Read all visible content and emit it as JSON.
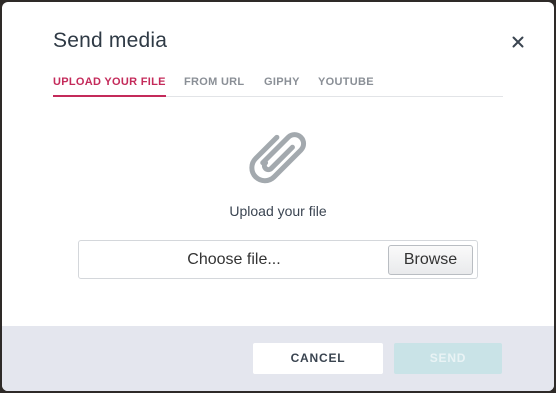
{
  "dialog": {
    "title": "Send media",
    "close_icon": "close-icon"
  },
  "tabs": [
    {
      "label": "UPLOAD YOUR FILE",
      "active": true
    },
    {
      "label": "FROM URL",
      "active": false
    },
    {
      "label": "GIPHY",
      "active": false
    },
    {
      "label": "YOUTUBE",
      "active": false
    }
  ],
  "upload": {
    "icon": "paperclip-icon",
    "label": "Upload your file",
    "file_placeholder": "Choose file...",
    "browse_label": "Browse"
  },
  "footer": {
    "cancel_label": "CANCEL",
    "send_label": "SEND",
    "send_enabled": false
  },
  "colors": {
    "accent": "#c42a5a",
    "send_disabled_bg": "#c9e3e7",
    "footer_bg": "#e4e6ee"
  }
}
